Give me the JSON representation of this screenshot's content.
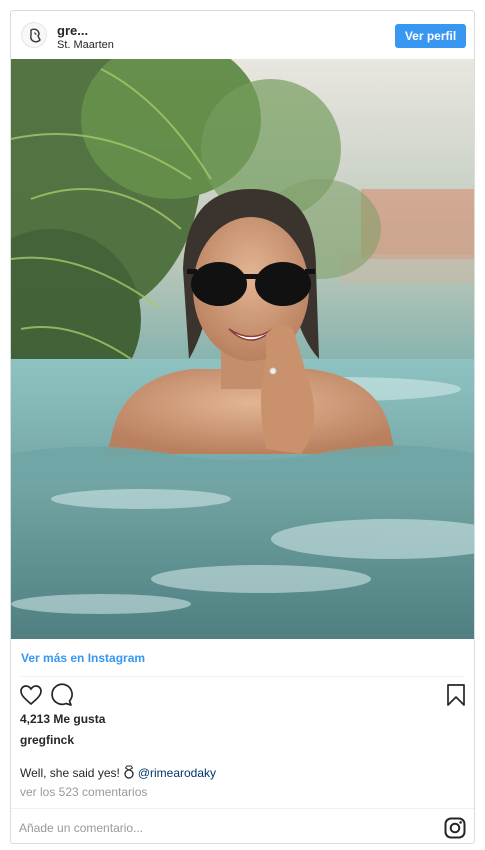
{
  "header": {
    "username": "gre...",
    "location": "St. Maarten",
    "profile_button": "Ver perfil"
  },
  "post": {
    "more_link": "Ver más en Instagram",
    "likes": "4,213 Me gusta",
    "owner": "gregfinck",
    "caption_text": "Well, she said yes!",
    "caption_mention": "@rimearodaky",
    "view_comments": "ver los 523 comentarios"
  },
  "comment_input": {
    "placeholder": "Añade un comentario..."
  },
  "icons": {
    "like": "heart-icon",
    "comment": "comment-icon",
    "save": "bookmark-icon",
    "logo": "instagram-logo-icon",
    "caption_emoji": "ring-icon"
  },
  "colors": {
    "accent": "#3897f0",
    "mention": "#003569",
    "muted": "#999999"
  }
}
